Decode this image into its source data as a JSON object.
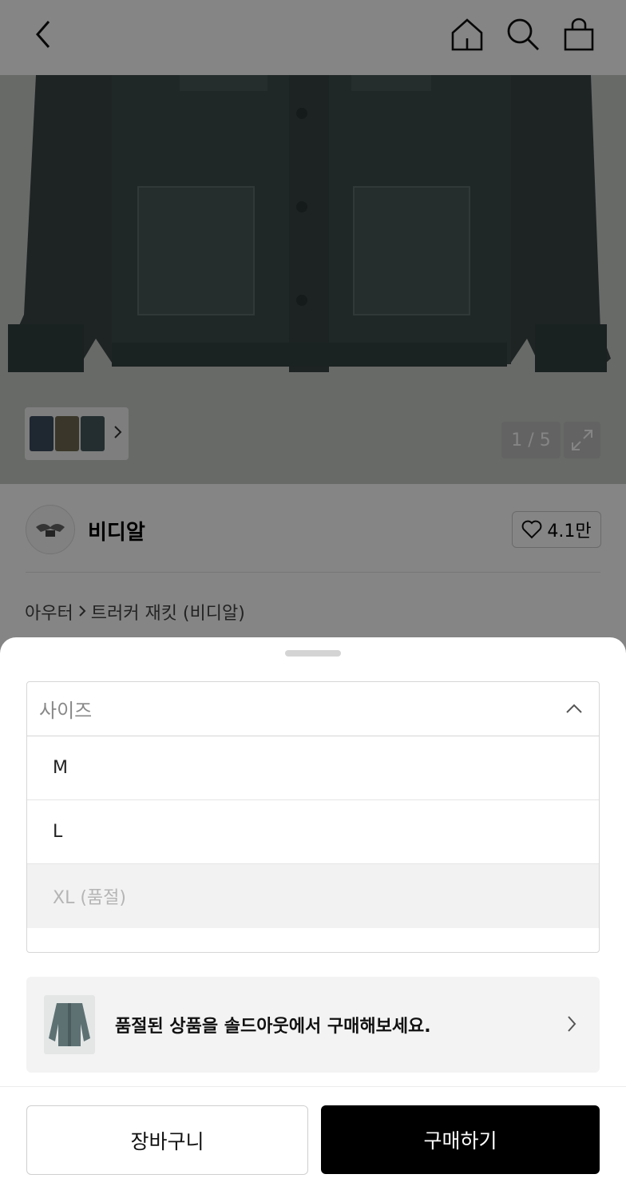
{
  "header": {
    "back_icon": "chevron-left-icon",
    "home_icon": "home-icon",
    "search_icon": "search-icon",
    "bag_icon": "shopping-bag-icon"
  },
  "gallery": {
    "counter": "1 / 5",
    "expand_icon": "expand-icon",
    "thumbnail_more_icon": "chevron-right-icon"
  },
  "brand": {
    "name": "비디알",
    "likes": "4.1만",
    "like_icon": "heart-icon"
  },
  "breadcrumb": {
    "category": "아우터",
    "product": "트러커 재킷 (비디알)",
    "separator_icon": "chevron-right-icon"
  },
  "sheet": {
    "select": {
      "placeholder": "사이즈",
      "toggle_icon": "chevron-up-icon",
      "options": [
        {
          "label": "M",
          "available": true
        },
        {
          "label": "L",
          "available": true
        },
        {
          "label": "XL (품절)",
          "available": false
        }
      ]
    },
    "soldout_banner": {
      "text": "품절된 상품을 솔드아웃에서 구매해보세요.",
      "icon": "chevron-right-icon"
    },
    "actions": {
      "cart_label": "장바구니",
      "buy_label": "구매하기"
    }
  },
  "colors": {
    "overlay": "#000000",
    "buy_button": "#000000",
    "disabled_option_bg": "#f2f2f2"
  }
}
